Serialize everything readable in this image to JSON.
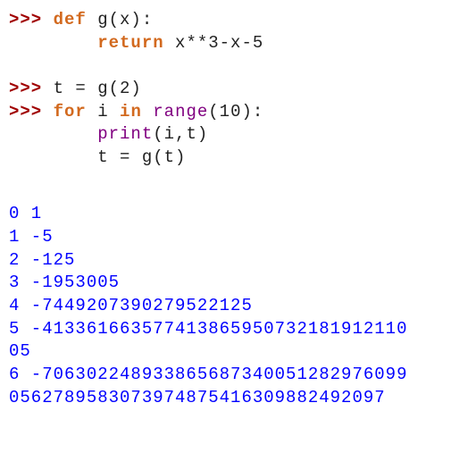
{
  "code": {
    "line1": {
      "prompt": ">>> ",
      "keyword": "def",
      "rest": " g(x):"
    },
    "line2": {
      "indent": "        ",
      "keyword": "return",
      "rest": " x**3-x-5"
    },
    "line3": {
      "prompt": ">>> ",
      "rest": "t = g(2)"
    },
    "line4": {
      "prompt": ">>> ",
      "keyword1": "for",
      "mid1": " i ",
      "keyword2": "in",
      "builtin": " range",
      "rest": "(10):"
    },
    "line5": {
      "indent": "        ",
      "builtin": "print",
      "rest": "(i,t)"
    },
    "line6": {
      "indent": "        ",
      "rest": "t = g(t)"
    }
  },
  "output": {
    "line0": "0 1",
    "line1": "1 -5",
    "line2": "2 -125",
    "line3": "3 -1953005",
    "line4": "4 -7449207390279522125",
    "line5": "5 -413361663577413865950732181912110\n05",
    "line6": "6 -706302248933865687340051282976099\n0562789583073974875416309882492097"
  }
}
